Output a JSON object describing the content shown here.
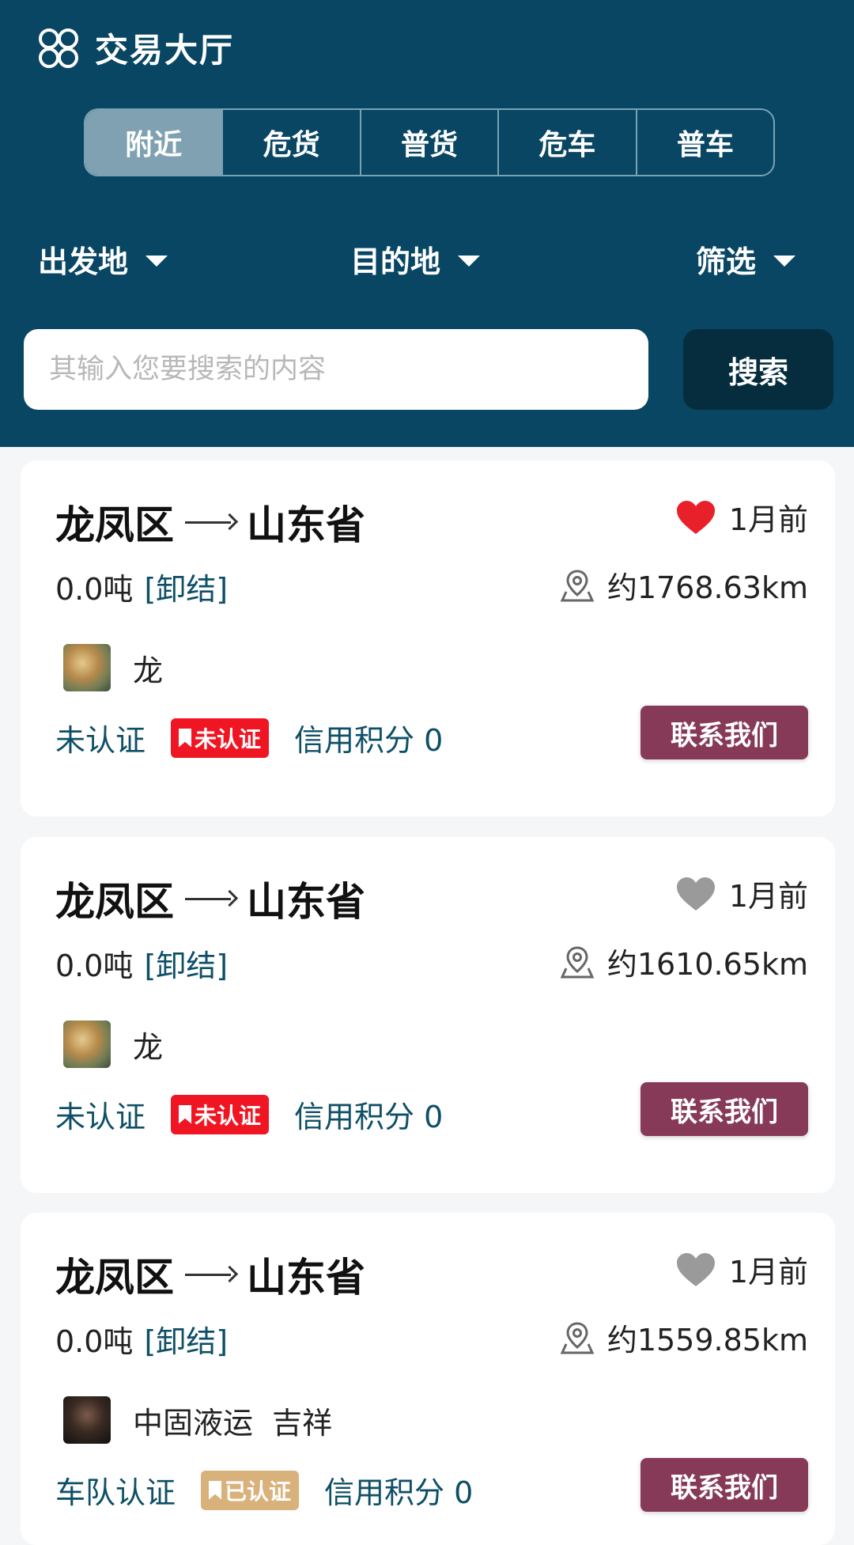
{
  "header": {
    "title": "交易大厅",
    "tabs": [
      {
        "label": "附近",
        "active": true
      },
      {
        "label": "危货",
        "active": false
      },
      {
        "label": "普货",
        "active": false
      },
      {
        "label": "危车",
        "active": false
      },
      {
        "label": "普车",
        "active": false
      }
    ],
    "filters": {
      "origin": "出发地",
      "destination": "目的地",
      "filter": "筛选"
    },
    "search": {
      "placeholder": "其输入您要搜索的内容",
      "button_label": "搜索"
    }
  },
  "colors": {
    "header_bg": "#084663",
    "active_tab": "#7fa1b1",
    "search_button": "#062d3e",
    "contact_button": "#873a57",
    "unverified_badge": "#f01522",
    "verified_badge": "#d8b27a",
    "heart_active": "#e8202a",
    "heart_inactive": "#9a9a9a"
  },
  "listings": [
    {
      "from": "龙凤区",
      "to": "山东省",
      "favorited": true,
      "time": "1月前",
      "weight": "0.0吨",
      "tag": "[卸结]",
      "distance": "约1768.63km",
      "user": "龙",
      "cert_status": "未认证",
      "badge": "未认证",
      "credit": "信用积分 0",
      "contact_label": "联系我们"
    },
    {
      "from": "龙凤区",
      "to": "山东省",
      "favorited": false,
      "time": "1月前",
      "weight": "0.0吨",
      "tag": "[卸结]",
      "distance": "约1610.65km",
      "user": "龙",
      "cert_status": "未认证",
      "badge": "未认证",
      "credit": "信用积分 0",
      "contact_label": "联系我们"
    },
    {
      "from": "龙凤区",
      "to": "山东省",
      "favorited": false,
      "time": "1月前",
      "weight": "0.0吨",
      "tag": "[卸结]",
      "distance": "约1559.85km",
      "user": "中固液运  吉祥",
      "cert_status": "车队认证",
      "badge": "已认证",
      "credit": "信用积分 0",
      "contact_label": "联系我们"
    }
  ]
}
